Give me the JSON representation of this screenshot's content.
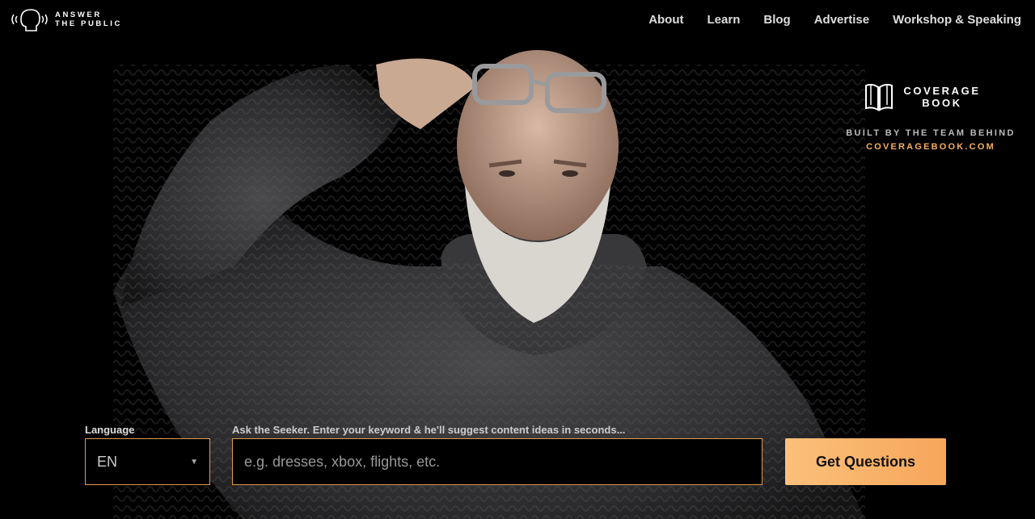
{
  "logo": {
    "line1": "ANSWER",
    "line2": "THE PUBLIC"
  },
  "nav": {
    "about": "About",
    "learn": "Learn",
    "blog": "Blog",
    "advertise": "Advertise",
    "workshop": "Workshop & Speaking"
  },
  "coverage": {
    "line1": "COVERAGE",
    "line2": "BOOK",
    "built": "BUILT BY THE TEAM BEHIND",
    "link": "COVERAGEBOOK.COM"
  },
  "search": {
    "language_label": "Language",
    "language_value": "EN",
    "keyword_label": "Ask the Seeker. Enter your keyword & he'll suggest content ideas in seconds...",
    "keyword_placeholder": "e.g. dresses, xbox, flights, etc.",
    "button_label": "Get Questions"
  },
  "colors": {
    "accent": "#f6ae5f",
    "border": "#e09b4f",
    "background": "#000000"
  }
}
